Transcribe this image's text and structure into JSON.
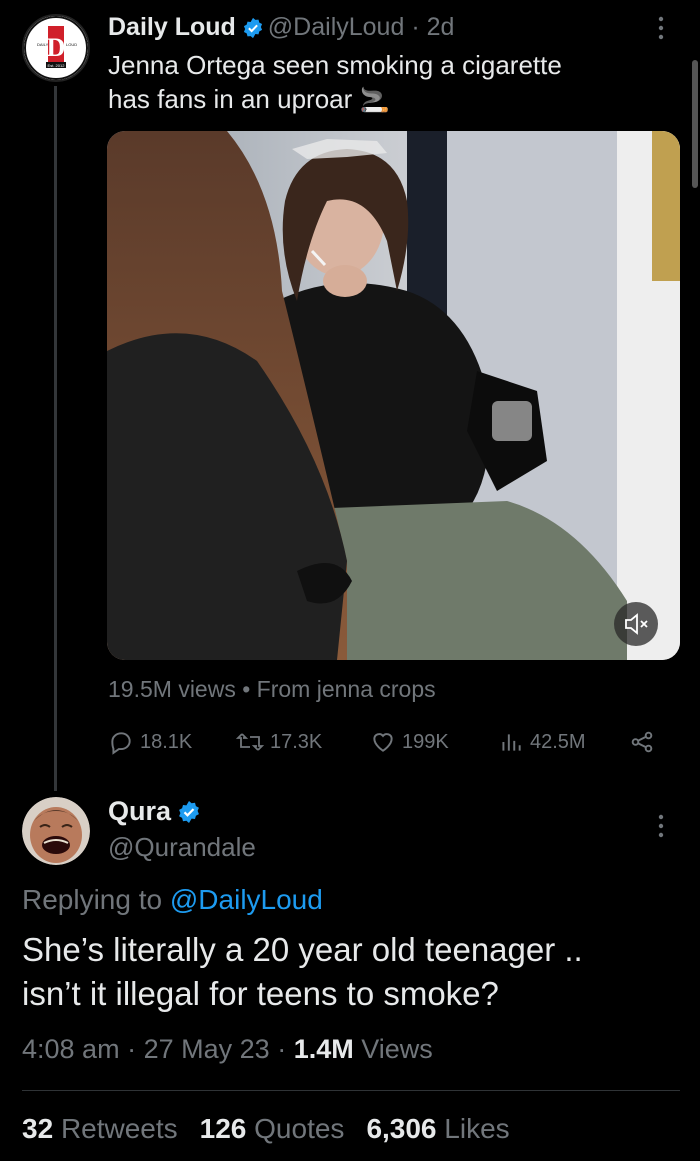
{
  "tweet": {
    "author_name": "Daily Loud",
    "author_handle": "@DailyLoud",
    "separator": "·",
    "time": "2d",
    "text_line1": "Jenna Ortega seen smoking a cigarette",
    "text_line2": "has fans in an uproar",
    "emoji": "🚬",
    "avatar_logo": {
      "left": "DAILY",
      "right": "LOUD",
      "bottom": "Est. 2012",
      "letter": "DL"
    },
    "media": {
      "type": "video",
      "muted": true
    },
    "views": "19.5M views",
    "from_sep": "•",
    "source": "From jenna crops",
    "actions": {
      "replies": "18.1K",
      "retweets": "17.3K",
      "likes": "199K",
      "views": "42.5M"
    }
  },
  "reply": {
    "author_name": "Qura",
    "author_handle": "@Qurandale",
    "replying_prefix": "Replying to",
    "replying_to": "@DailyLoud",
    "text_line1": "She’s literally a 20 year old teenager ..",
    "text_line2": "isn’t it illegal for teens to smoke?",
    "time": "4:08 am",
    "date": "27 May 23",
    "sep": "·",
    "views_count": "1.4M",
    "views_label": "Views",
    "retweets_count": "32",
    "retweets_label": "Retweets",
    "quotes_count": "126",
    "quotes_label": "Quotes",
    "likes_count": "6,306",
    "likes_label": "Likes"
  },
  "colors": {
    "background": "#000000",
    "text": "#e7e9ea",
    "muted": "#71767b",
    "accent": "#1d9bf0",
    "logo_red": "#d0202a"
  },
  "icons": [
    "more-vertical-icon",
    "verified-badge-icon",
    "reply-icon",
    "retweet-icon",
    "like-icon",
    "views-chart-icon",
    "share-icon",
    "mute-icon"
  ]
}
